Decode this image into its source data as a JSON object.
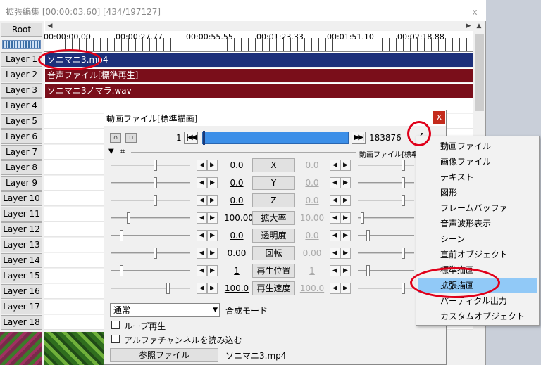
{
  "timeline": {
    "title": "拡張編集 [00:00:03.60] [434/197127]",
    "close": "x",
    "root_label": "Root",
    "ruler_labels": [
      "00:00:00.00",
      "00:00:27.77",
      "00:00:55.55",
      "00:01:23.33",
      "00:01:51.10",
      "00:02:18.88"
    ],
    "layers": [
      "Layer 1",
      "Layer 2",
      "Layer 3",
      "Layer 4",
      "Layer 5",
      "Layer 6",
      "Layer 7",
      "Layer 8",
      "Layer 9",
      "Layer 10",
      "Layer 11",
      "Layer 12",
      "Layer 13",
      "Layer 14",
      "Layer 15",
      "Layer 16",
      "Layer 17",
      "Layer 18"
    ],
    "clips": [
      {
        "layer": 1,
        "label": "ソニマニ3.mp4",
        "color": "#1c2f7a"
      },
      {
        "layer": 2,
        "label": "音声ファイル[標準再生]",
        "color": "#7a0e1a"
      },
      {
        "layer": 3,
        "label": "ソニマニ3ノマラ.wav",
        "color": "#7a0e1a"
      }
    ]
  },
  "dialog": {
    "title": "動画ファイル[標準描画]",
    "close": "x",
    "frame_start": "1",
    "frame_end": "183876",
    "frame_progress": 0.0,
    "right_label": "動画ファイル[標準描",
    "params": [
      {
        "value": "0.0",
        "label": "X",
        "end_value": "0.0"
      },
      {
        "value": "0.0",
        "label": "Y",
        "end_value": "0.0"
      },
      {
        "value": "0.0",
        "label": "Z",
        "end_value": "0.0"
      },
      {
        "value": "100.00",
        "label": "拡大率",
        "end_value": "10.00"
      },
      {
        "value": "0.0",
        "label": "透明度",
        "end_value": "0.0"
      },
      {
        "value": "0.00",
        "label": "回転",
        "end_value": "0.00"
      },
      {
        "value": "1",
        "label": "再生位置",
        "end_value": "1"
      },
      {
        "value": "100.0",
        "label": "再生速度",
        "end_value": "100.0"
      }
    ],
    "blend_mode": "通常",
    "blend_label": "合成モード",
    "loop_label": "ループ再生",
    "alpha_label": "アルファチャンネルを読み込む",
    "ref_button": "参照ファイル",
    "ref_file": "ソニマニ3.mp4"
  },
  "menu": {
    "items": [
      "動画ファイル",
      "画像ファイル",
      "テキスト",
      "図形",
      "フレームバッファ",
      "音声波形表示",
      "シーン",
      "直前オブジェクト",
      "標準描画",
      "拡張描画",
      "パーティクル出力",
      "カスタムオブジェクト"
    ],
    "selected_index": 9
  },
  "colors": {
    "annotation": "#e0001a",
    "menu_highlight": "#91c9f7",
    "frame_bar": "#3c8fe8"
  }
}
